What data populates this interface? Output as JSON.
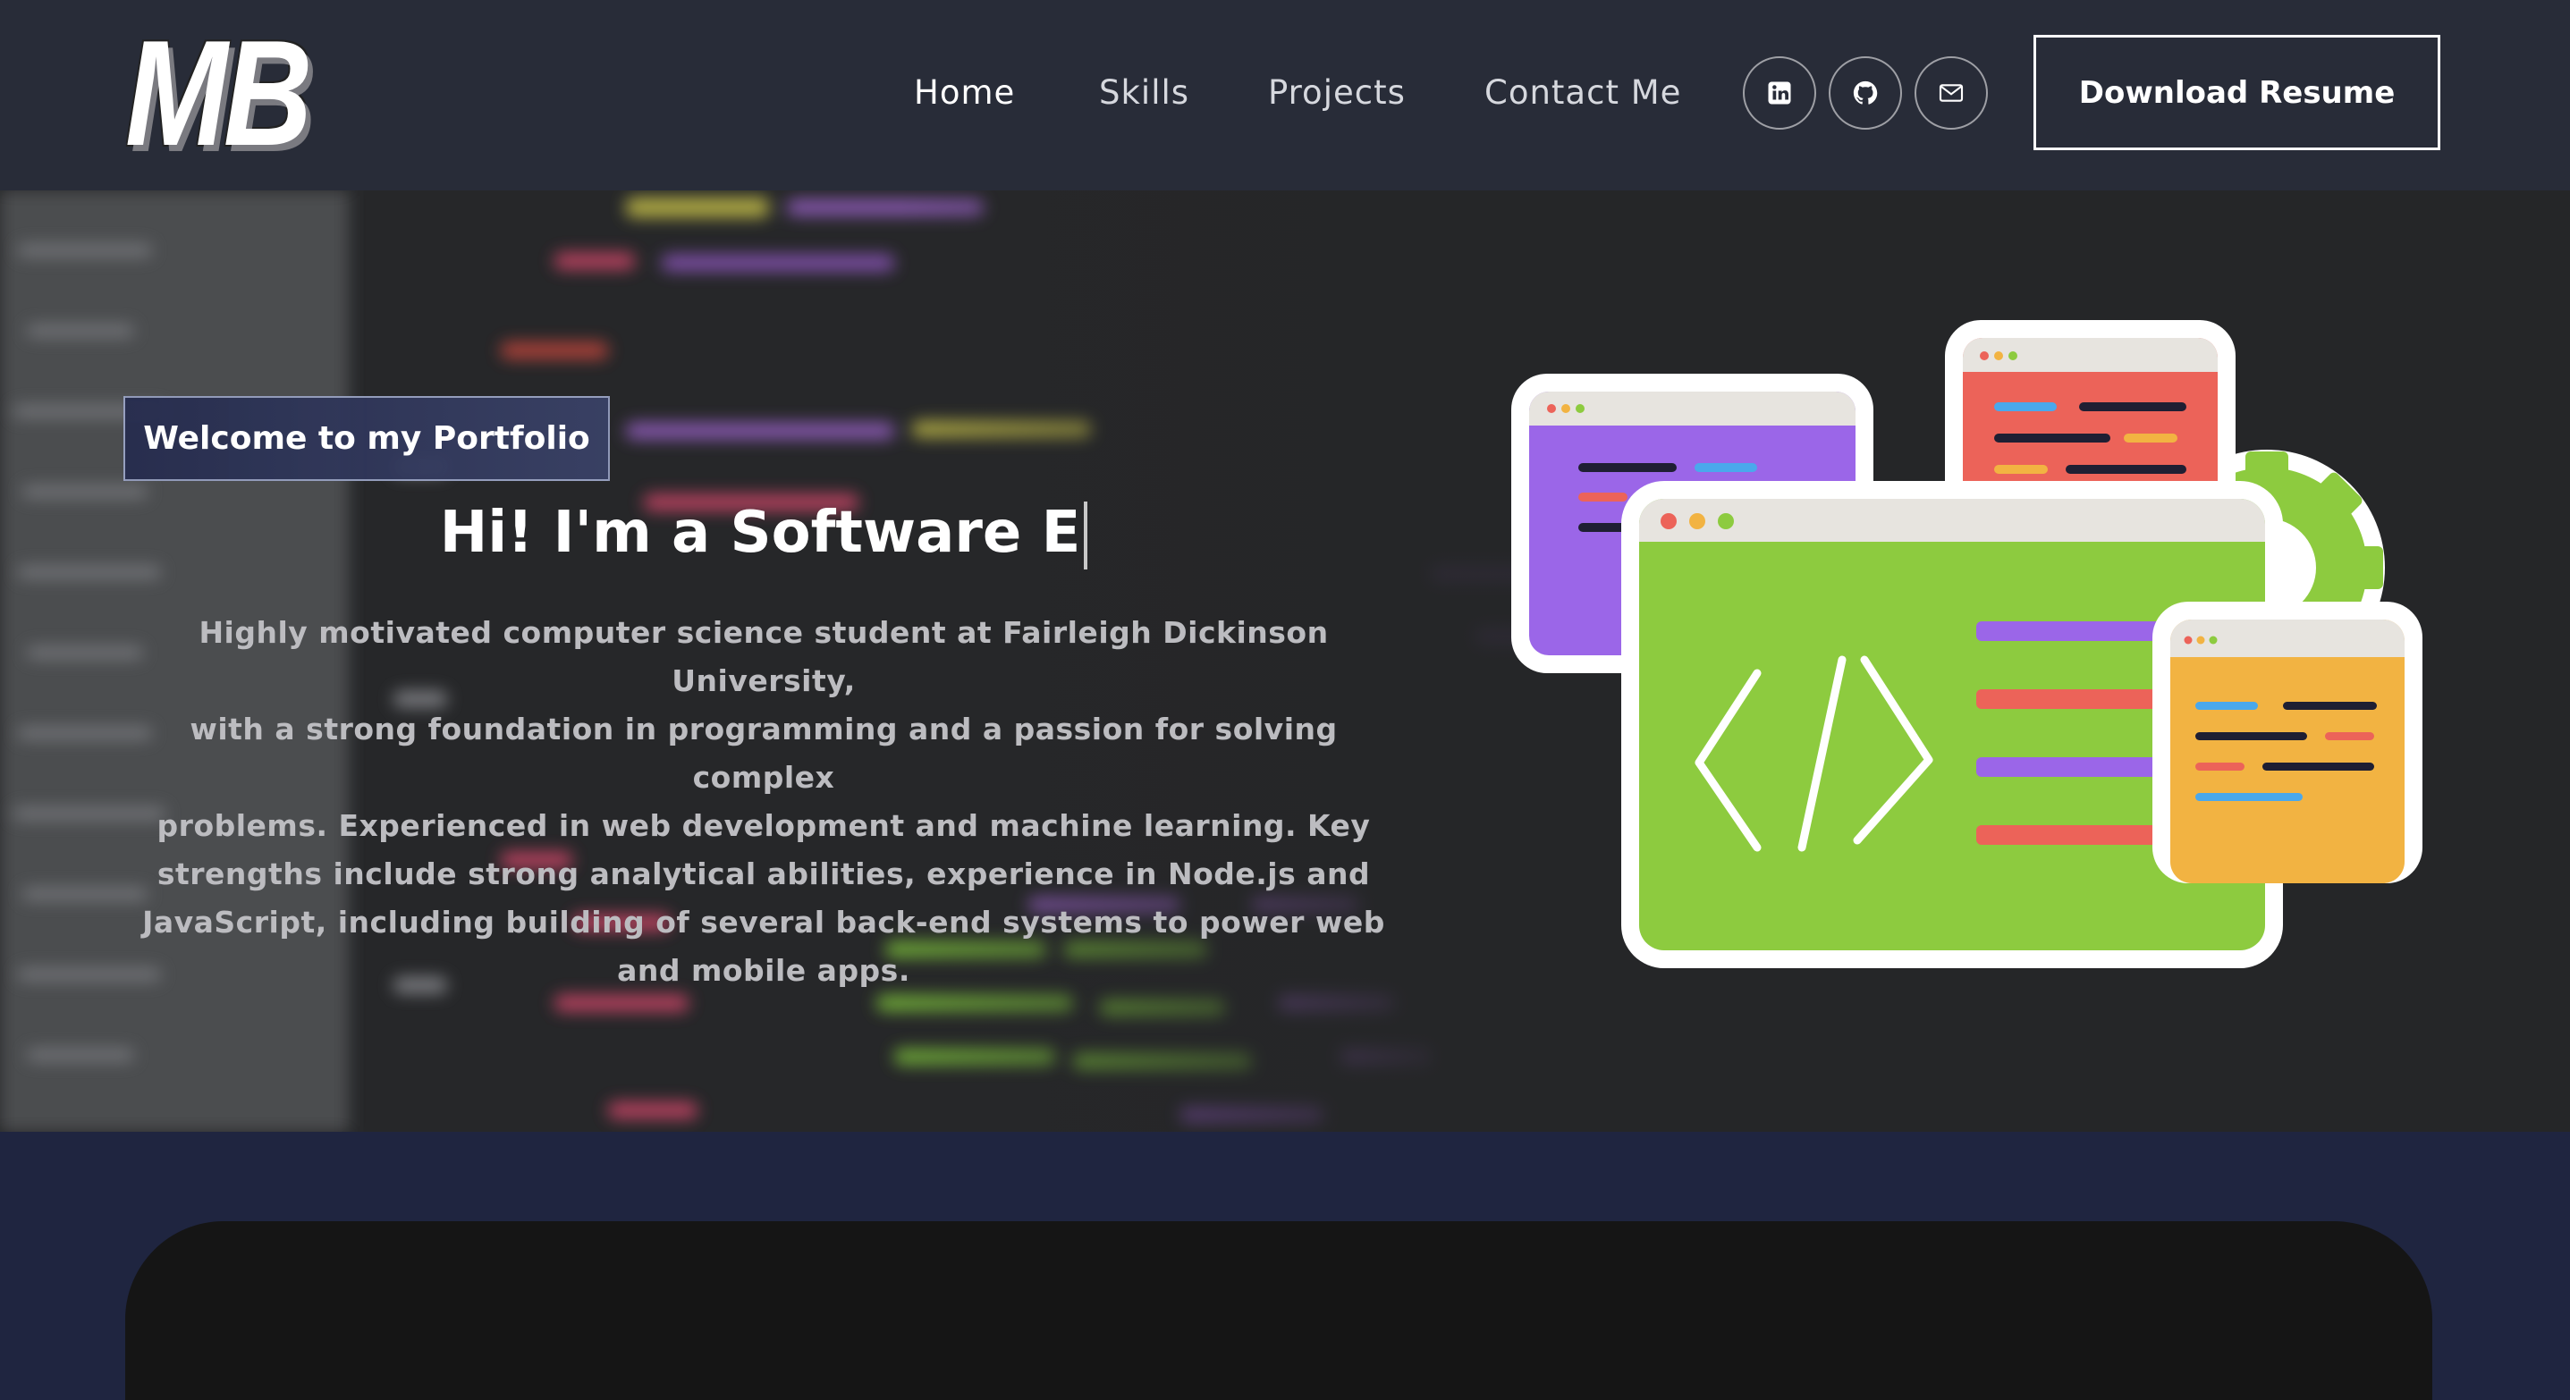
{
  "brand": {
    "logo_text": "MB"
  },
  "nav": {
    "links": [
      {
        "label": "Home"
      },
      {
        "label": "Skills"
      },
      {
        "label": "Projects"
      },
      {
        "label": "Contact Me"
      }
    ],
    "social": [
      "linkedin-icon",
      "github-icon",
      "mail-icon"
    ],
    "download_label": "Download Resume"
  },
  "hero": {
    "tagline": "Welcome to my Portfolio",
    "headline": "Hi! I'm a Software E",
    "bio_lines": [
      "Highly motivated computer science student at Fairleigh Dickinson University,",
      "with a strong foundation in programming and a passion for solving complex",
      "problems. Experienced in web development and machine learning. Key",
      "strengths include strong analytical abilities, experience in Node.js and",
      "JavaScript, including building of several back-end systems to power web",
      "and mobile apps."
    ]
  },
  "colors": {
    "navbar_bg": "#282c38",
    "hero_bg": "#252628",
    "section_bg": "#1f2540",
    "card_bg": "#151515",
    "purple": "#9b66e8",
    "red": "#ec6359",
    "green": "#8dcb3f",
    "orange": "#f2b342",
    "blue": "#4aa8ec"
  }
}
